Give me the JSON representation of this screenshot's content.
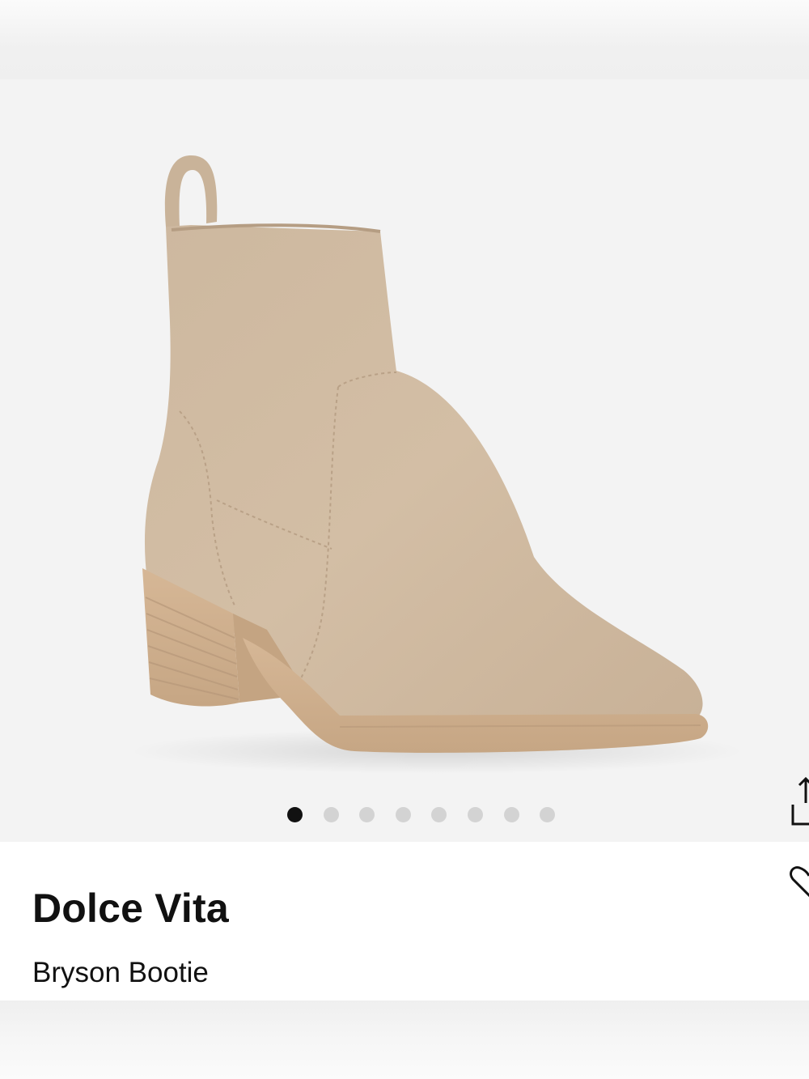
{
  "gallery": {
    "image_label": "product-photo-tan-suede-ankle-boot",
    "total_images": 8,
    "active_index": 0
  },
  "product": {
    "brand": "Dolce Vita",
    "name": "Bryson Bootie"
  },
  "actions": {
    "share_icon": "share-icon",
    "favorite_icon": "heart-icon"
  },
  "colors": {
    "boot_suede": "#d0bba2",
    "boot_sole": "#cfae8c",
    "dot_active": "#111111",
    "dot_inactive": "#d3d3d3"
  }
}
